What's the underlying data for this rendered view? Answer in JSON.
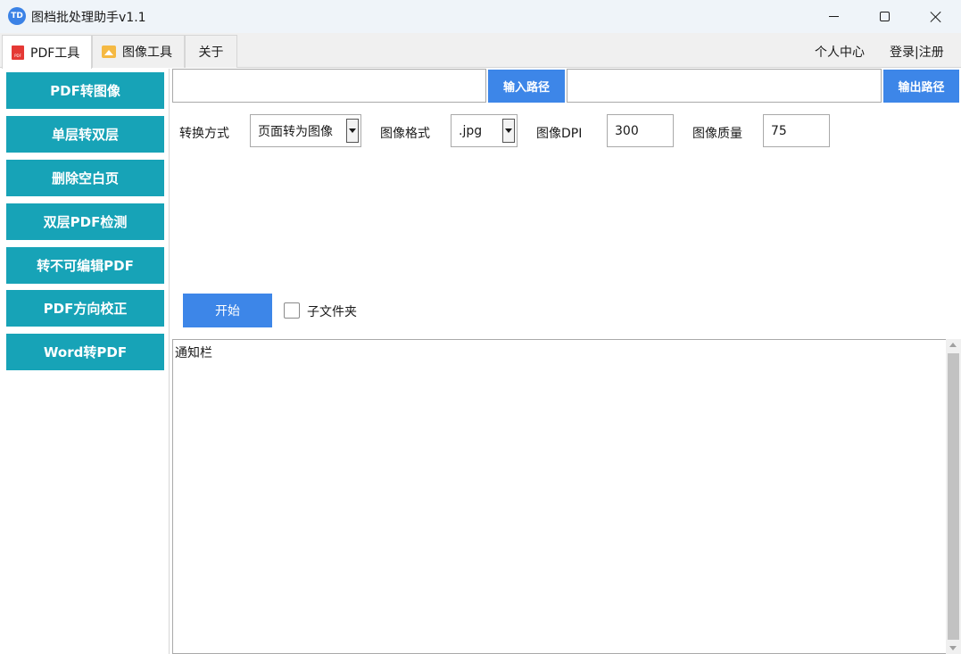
{
  "window": {
    "app_icon_text": "TD",
    "title": "图档批处理助手v1.1"
  },
  "tabs": [
    {
      "label": "PDF工具",
      "icon": "pdf-file-icon",
      "active": true
    },
    {
      "label": "图像工具",
      "icon": "image-icon",
      "active": false
    },
    {
      "label": "关于",
      "active": false
    }
  ],
  "top_links": {
    "personal": "个人中心",
    "login": "登录|注册"
  },
  "sidebar": {
    "items": [
      {
        "label": "PDF转图像"
      },
      {
        "label": "单层转双层"
      },
      {
        "label": "删除空白页"
      },
      {
        "label": "双层PDF检测"
      },
      {
        "label": "转不可编辑PDF"
      },
      {
        "label": "PDF方向校正"
      },
      {
        "label": "Word转PDF"
      }
    ]
  },
  "paths": {
    "input_value": "",
    "input_button": "输入路径",
    "output_value": "",
    "output_button": "输出路径"
  },
  "options": {
    "conversion_label": "转换方式",
    "conversion_value": "页面转为图像",
    "format_label": "图像格式",
    "format_value": ".jpg",
    "dpi_label": "图像DPI",
    "dpi_value": "300",
    "quality_label": "图像质量",
    "quality_value": "75"
  },
  "actions": {
    "start": "开始",
    "subfolder_label": "子文件夹",
    "subfolder_checked": false
  },
  "notification": {
    "text": "通知栏"
  },
  "colors": {
    "sidebar_button": "#17a3b7",
    "primary_button": "#3d86e8",
    "titlebar": "#eff4f9"
  }
}
